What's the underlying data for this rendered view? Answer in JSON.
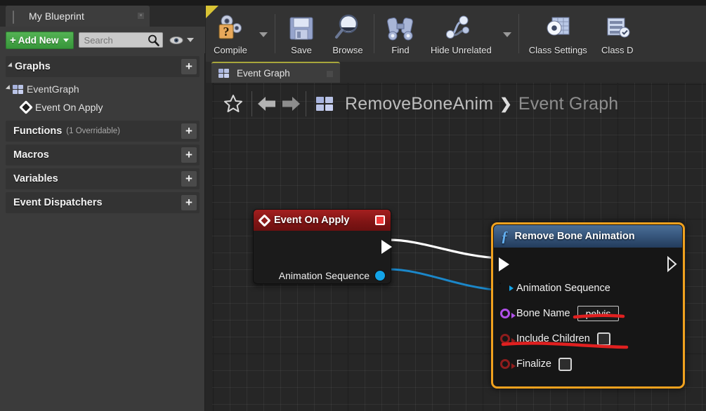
{
  "left_panel": {
    "tab": {
      "label": "My Blueprint",
      "icon": "book-icon",
      "close": "×"
    },
    "toolbar": {
      "add_new_label": "Add New",
      "add_new_plus": "+",
      "search_placeholder": "Search",
      "search_value": "",
      "search_icon": "magnifier-icon",
      "eye_icon": "eye-icon"
    },
    "sections": [
      {
        "name": "graphs",
        "title": "Graphs",
        "sub": "",
        "plus": "+",
        "expanded": true
      },
      {
        "name": "functions",
        "title": "Functions",
        "sub": "(1 Overridable)",
        "plus": "+",
        "expanded": false
      },
      {
        "name": "macros",
        "title": "Macros",
        "sub": "",
        "plus": "+",
        "expanded": false
      },
      {
        "name": "variables",
        "title": "Variables",
        "sub": "",
        "plus": "+",
        "expanded": false
      },
      {
        "name": "event-dispatchers",
        "title": "Event Dispatchers",
        "sub": "",
        "plus": "+",
        "expanded": false
      }
    ],
    "graph_item": {
      "label": "EventGraph",
      "icon": "grid-4-icon"
    },
    "event_item": {
      "label": "Event On Apply",
      "icon": "event-diamond-icon"
    }
  },
  "toolbar": {
    "items": [
      {
        "name": "compile",
        "label": "Compile",
        "icon": "compile-gears-question-icon",
        "has_dropdown": true
      },
      {
        "name": "save",
        "label": "Save",
        "icon": "floppy-disk-icon",
        "has_dropdown": false
      },
      {
        "name": "browse",
        "label": "Browse",
        "icon": "magnifier-icon",
        "has_dropdown": false
      },
      {
        "name": "find",
        "label": "Find",
        "icon": "binoculars-icon",
        "has_dropdown": false
      },
      {
        "name": "hide-unrelated",
        "label": "Hide Unrelated",
        "icon": "node-graph-icon",
        "has_dropdown": true
      },
      {
        "name": "class-settings",
        "label": "Class Settings",
        "icon": "gear-window-icon",
        "has_dropdown": false
      },
      {
        "name": "class-defaults",
        "label": "Class D",
        "icon": "class-defaults-icon",
        "has_dropdown": false
      }
    ]
  },
  "graph_tab": {
    "label": "Event Graph",
    "icon": "grid-4-icon",
    "close": "×"
  },
  "breadcrumb": {
    "star_icon": "favorite-star-icon",
    "back_icon": "arrow-left-icon",
    "forward_icon": "arrow-right-icon",
    "graph_icon": "grid-4-icon",
    "root": "RemoveBoneAnim",
    "separator": "❯",
    "current": "Event Graph"
  },
  "nodes": {
    "event_node": {
      "title": "Event On Apply",
      "title_icon": "event-diamond-icon",
      "delegate_icon": "delegate-square-icon",
      "exec_out_pin": "exec-out-pin",
      "outputs": [
        {
          "label": "Animation Sequence",
          "pin": "object-pin",
          "color": "#13a4e8"
        }
      ],
      "header_color": "#8e1818"
    },
    "function_node": {
      "title": "Remove Bone Animation",
      "title_icon": "function-f-icon",
      "selected": true,
      "selection_color": "#f0a11e",
      "header_color": "#3c5d84",
      "exec_in_pin": "exec-in-pin",
      "exec_out_pin": "exec-out-pin",
      "inputs": [
        {
          "label": "Animation Sequence",
          "type": "object",
          "pin_color": "#13a4e8",
          "widget": "none",
          "value": ""
        },
        {
          "label": "Bone Name",
          "type": "name",
          "pin_color": "#b050e8",
          "widget": "text",
          "value": "pelvis"
        },
        {
          "label": "Include Children",
          "type": "bool",
          "pin_color": "#8f1d1d",
          "widget": "checkbox",
          "value": "unchecked"
        },
        {
          "label": "Finalize",
          "type": "bool",
          "pin_color": "#8f1d1d",
          "widget": "checkbox",
          "value": "unchecked"
        }
      ]
    }
  },
  "wires": [
    {
      "name": "exec-wire",
      "color": "#ffffff",
      "from": "event-exec-out",
      "to": "fn-exec-in"
    },
    {
      "name": "data-wire",
      "color": "#1b87c9",
      "from": "event-anim-seq",
      "to": "fn-anim-seq"
    }
  ],
  "annotations": [
    {
      "name": "underline-bone-name",
      "color": "#e02020"
    },
    {
      "name": "underline-include-children",
      "color": "#e02020"
    }
  ]
}
